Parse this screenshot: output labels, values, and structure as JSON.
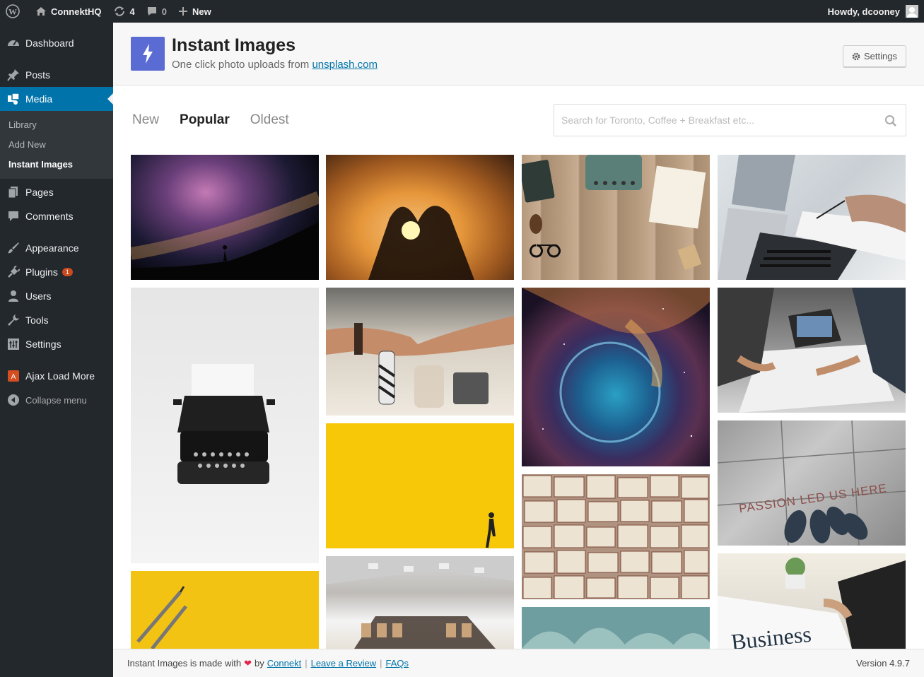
{
  "adminbar": {
    "site_name": "ConnektHQ",
    "updates_count": "4",
    "comments_count": "0",
    "new_label": "New",
    "greeting": "Howdy, dcooney"
  },
  "sidebar": {
    "dashboard": "Dashboard",
    "posts": "Posts",
    "media": "Media",
    "media_sub": [
      "Library",
      "Add New",
      "Instant Images"
    ],
    "pages": "Pages",
    "comments": "Comments",
    "appearance": "Appearance",
    "plugins": "Plugins",
    "plugins_badge": "1",
    "users": "Users",
    "tools": "Tools",
    "settings": "Settings",
    "ajax_load_more": "Ajax Load More",
    "collapse": "Collapse menu"
  },
  "header": {
    "title": "Instant Images",
    "subtitle_prefix": "One click photo uploads from",
    "subtitle_link": "unsplash.com",
    "settings_label": "Settings"
  },
  "tabs": [
    "New",
    "Popular",
    "Oldest"
  ],
  "active_tab": "Popular",
  "search": {
    "placeholder": "Search for Toronto, Coffee + Breakfast etc..."
  },
  "photos": [
    "milky-way-night-sky",
    "heart-hands-sunset",
    "typewriter-wood-desk",
    "laptop-meeting-notes",
    "typewriter-white-background",
    "fist-bump-team",
    "bubble-nebula-space",
    "team-laptop-papers",
    "yellow-wall-walker",
    "open-books-grid",
    "passion-led-us-here",
    "pencils-yellow",
    "conference-room",
    "succulent-leaves",
    "business-newspaper"
  ],
  "footer": {
    "made_with": "Instant Images is made with",
    "by": "by",
    "connekt": "Connekt",
    "review": "Leave a Review",
    "faqs": "FAQs",
    "version": "Version 4.9.7"
  },
  "colors": {
    "admin_dark": "#23282d",
    "active_blue": "#0073aa",
    "logo_purple": "#5b6bd4",
    "badge_red": "#ca4a1f"
  }
}
